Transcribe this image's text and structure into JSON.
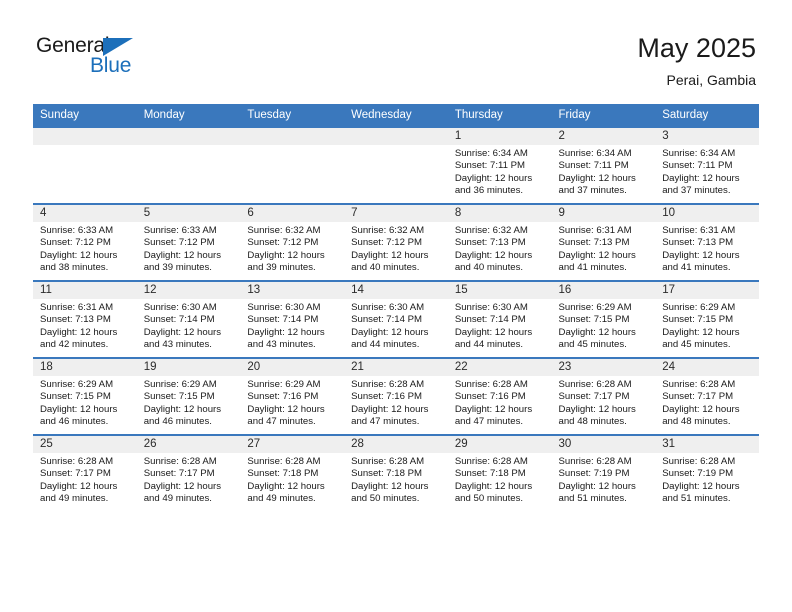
{
  "brand": {
    "name_top": "General",
    "name_bottom": "Blue",
    "accent_color": "#1c6fba"
  },
  "header": {
    "title": "May 2025",
    "subtitle": "Perai, Gambia"
  },
  "theme": {
    "header_row_bg": "#3a78bd",
    "daynum_band_bg": "#efefef",
    "grid_line": "#3a78bd"
  },
  "weekday_headers": [
    "Sunday",
    "Monday",
    "Tuesday",
    "Wednesday",
    "Thursday",
    "Friday",
    "Saturday"
  ],
  "labels": {
    "sunrise_prefix": "Sunrise: ",
    "sunset_prefix": "Sunset: ",
    "daylight_prefix": "Daylight: "
  },
  "weeks": [
    [
      {
        "day": "",
        "sunrise": "",
        "sunset": "",
        "daylight": "",
        "empty": true
      },
      {
        "day": "",
        "sunrise": "",
        "sunset": "",
        "daylight": "",
        "empty": true
      },
      {
        "day": "",
        "sunrise": "",
        "sunset": "",
        "daylight": "",
        "empty": true
      },
      {
        "day": "",
        "sunrise": "",
        "sunset": "",
        "daylight": "",
        "empty": true
      },
      {
        "day": "1",
        "sunrise": "Sunrise: 6:34 AM",
        "sunset": "Sunset: 7:11 PM",
        "daylight": "Daylight: 12 hours and 36 minutes."
      },
      {
        "day": "2",
        "sunrise": "Sunrise: 6:34 AM",
        "sunset": "Sunset: 7:11 PM",
        "daylight": "Daylight: 12 hours and 37 minutes."
      },
      {
        "day": "3",
        "sunrise": "Sunrise: 6:34 AM",
        "sunset": "Sunset: 7:11 PM",
        "daylight": "Daylight: 12 hours and 37 minutes."
      }
    ],
    [
      {
        "day": "4",
        "sunrise": "Sunrise: 6:33 AM",
        "sunset": "Sunset: 7:12 PM",
        "daylight": "Daylight: 12 hours and 38 minutes."
      },
      {
        "day": "5",
        "sunrise": "Sunrise: 6:33 AM",
        "sunset": "Sunset: 7:12 PM",
        "daylight": "Daylight: 12 hours and 39 minutes."
      },
      {
        "day": "6",
        "sunrise": "Sunrise: 6:32 AM",
        "sunset": "Sunset: 7:12 PM",
        "daylight": "Daylight: 12 hours and 39 minutes."
      },
      {
        "day": "7",
        "sunrise": "Sunrise: 6:32 AM",
        "sunset": "Sunset: 7:12 PM",
        "daylight": "Daylight: 12 hours and 40 minutes."
      },
      {
        "day": "8",
        "sunrise": "Sunrise: 6:32 AM",
        "sunset": "Sunset: 7:13 PM",
        "daylight": "Daylight: 12 hours and 40 minutes."
      },
      {
        "day": "9",
        "sunrise": "Sunrise: 6:31 AM",
        "sunset": "Sunset: 7:13 PM",
        "daylight": "Daylight: 12 hours and 41 minutes."
      },
      {
        "day": "10",
        "sunrise": "Sunrise: 6:31 AM",
        "sunset": "Sunset: 7:13 PM",
        "daylight": "Daylight: 12 hours and 41 minutes."
      }
    ],
    [
      {
        "day": "11",
        "sunrise": "Sunrise: 6:31 AM",
        "sunset": "Sunset: 7:13 PM",
        "daylight": "Daylight: 12 hours and 42 minutes."
      },
      {
        "day": "12",
        "sunrise": "Sunrise: 6:30 AM",
        "sunset": "Sunset: 7:14 PM",
        "daylight": "Daylight: 12 hours and 43 minutes."
      },
      {
        "day": "13",
        "sunrise": "Sunrise: 6:30 AM",
        "sunset": "Sunset: 7:14 PM",
        "daylight": "Daylight: 12 hours and 43 minutes."
      },
      {
        "day": "14",
        "sunrise": "Sunrise: 6:30 AM",
        "sunset": "Sunset: 7:14 PM",
        "daylight": "Daylight: 12 hours and 44 minutes."
      },
      {
        "day": "15",
        "sunrise": "Sunrise: 6:30 AM",
        "sunset": "Sunset: 7:14 PM",
        "daylight": "Daylight: 12 hours and 44 minutes."
      },
      {
        "day": "16",
        "sunrise": "Sunrise: 6:29 AM",
        "sunset": "Sunset: 7:15 PM",
        "daylight": "Daylight: 12 hours and 45 minutes."
      },
      {
        "day": "17",
        "sunrise": "Sunrise: 6:29 AM",
        "sunset": "Sunset: 7:15 PM",
        "daylight": "Daylight: 12 hours and 45 minutes."
      }
    ],
    [
      {
        "day": "18",
        "sunrise": "Sunrise: 6:29 AM",
        "sunset": "Sunset: 7:15 PM",
        "daylight": "Daylight: 12 hours and 46 minutes."
      },
      {
        "day": "19",
        "sunrise": "Sunrise: 6:29 AM",
        "sunset": "Sunset: 7:15 PM",
        "daylight": "Daylight: 12 hours and 46 minutes."
      },
      {
        "day": "20",
        "sunrise": "Sunrise: 6:29 AM",
        "sunset": "Sunset: 7:16 PM",
        "daylight": "Daylight: 12 hours and 47 minutes."
      },
      {
        "day": "21",
        "sunrise": "Sunrise: 6:28 AM",
        "sunset": "Sunset: 7:16 PM",
        "daylight": "Daylight: 12 hours and 47 minutes."
      },
      {
        "day": "22",
        "sunrise": "Sunrise: 6:28 AM",
        "sunset": "Sunset: 7:16 PM",
        "daylight": "Daylight: 12 hours and 47 minutes."
      },
      {
        "day": "23",
        "sunrise": "Sunrise: 6:28 AM",
        "sunset": "Sunset: 7:17 PM",
        "daylight": "Daylight: 12 hours and 48 minutes."
      },
      {
        "day": "24",
        "sunrise": "Sunrise: 6:28 AM",
        "sunset": "Sunset: 7:17 PM",
        "daylight": "Daylight: 12 hours and 48 minutes."
      }
    ],
    [
      {
        "day": "25",
        "sunrise": "Sunrise: 6:28 AM",
        "sunset": "Sunset: 7:17 PM",
        "daylight": "Daylight: 12 hours and 49 minutes."
      },
      {
        "day": "26",
        "sunrise": "Sunrise: 6:28 AM",
        "sunset": "Sunset: 7:17 PM",
        "daylight": "Daylight: 12 hours and 49 minutes."
      },
      {
        "day": "27",
        "sunrise": "Sunrise: 6:28 AM",
        "sunset": "Sunset: 7:18 PM",
        "daylight": "Daylight: 12 hours and 49 minutes."
      },
      {
        "day": "28",
        "sunrise": "Sunrise: 6:28 AM",
        "sunset": "Sunset: 7:18 PM",
        "daylight": "Daylight: 12 hours and 50 minutes."
      },
      {
        "day": "29",
        "sunrise": "Sunrise: 6:28 AM",
        "sunset": "Sunset: 7:18 PM",
        "daylight": "Daylight: 12 hours and 50 minutes."
      },
      {
        "day": "30",
        "sunrise": "Sunrise: 6:28 AM",
        "sunset": "Sunset: 7:19 PM",
        "daylight": "Daylight: 12 hours and 51 minutes."
      },
      {
        "day": "31",
        "sunrise": "Sunrise: 6:28 AM",
        "sunset": "Sunset: 7:19 PM",
        "daylight": "Daylight: 12 hours and 51 minutes."
      }
    ]
  ]
}
